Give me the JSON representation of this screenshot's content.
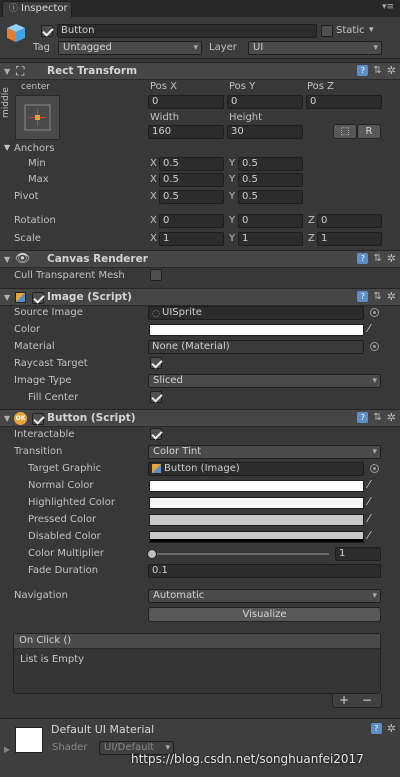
{
  "tab": {
    "label": "Inspector"
  },
  "header": {
    "object_name": "Button",
    "static_label": "Static",
    "tag_label": "Tag",
    "tag_value": "Untagged",
    "layer_label": "Layer",
    "layer_value": "UI"
  },
  "rect_transform": {
    "title": "Rect Transform",
    "anchor_h": "center",
    "anchor_v": "middle",
    "pos_x_label": "Pos X",
    "pos_y_label": "Pos Y",
    "pos_z_label": "Pos Z",
    "pos_x": "0",
    "pos_y": "0",
    "pos_z": "0",
    "width_label": "Width",
    "height_label": "Height",
    "width": "160",
    "height": "30",
    "raw_button": "R",
    "anchors_label": "Anchors",
    "min_label": "Min",
    "max_label": "Max",
    "min_x": "0.5",
    "min_y": "0.5",
    "max_x": "0.5",
    "max_y": "0.5",
    "pivot_label": "Pivot",
    "pivot_x": "0.5",
    "pivot_y": "0.5",
    "rotation_label": "Rotation",
    "rot_x": "0",
    "rot_y": "0",
    "rot_z": "0",
    "scale_label": "Scale",
    "scale_x": "1",
    "scale_y": "1",
    "scale_z": "1",
    "x": "X",
    "y": "Y",
    "z": "Z"
  },
  "canvas_renderer": {
    "title": "Canvas Renderer",
    "cull_label": "Cull Transparent Mesh"
  },
  "image": {
    "title": "Image (Script)",
    "source_label": "Source Image",
    "source_value": "UISprite",
    "color_label": "Color",
    "material_label": "Material",
    "material_value": "None (Material)",
    "raycast_label": "Raycast Target",
    "type_label": "Image Type",
    "type_value": "Sliced",
    "fill_label": "Fill Center"
  },
  "button": {
    "title": "Button (Script)",
    "interactable_label": "Interactable",
    "transition_label": "Transition",
    "transition_value": "Color Tint",
    "target_label": "Target Graphic",
    "target_value": "Button (Image)",
    "normal_label": "Normal Color",
    "highlighted_label": "Highlighted Color",
    "pressed_label": "Pressed Color",
    "disabled_label": "Disabled Color",
    "multiplier_label": "Color Multiplier",
    "multiplier_value": "1",
    "fade_label": "Fade Duration",
    "fade_value": "0.1",
    "navigation_label": "Navigation",
    "navigation_value": "Automatic",
    "visualize_label": "Visualize",
    "onclick_title": "On Click ()",
    "onclick_empty": "List is Empty",
    "add": "+",
    "remove": "−"
  },
  "material": {
    "name": "Default UI Material",
    "shader_label": "Shader",
    "shader_value": "UI/Default"
  },
  "watermark": "https://blog.csdn.net/songhuanfei2017",
  "colors": {
    "accent": "#5c8fc9",
    "panel": "#383838",
    "field": "#2c2c2c"
  }
}
